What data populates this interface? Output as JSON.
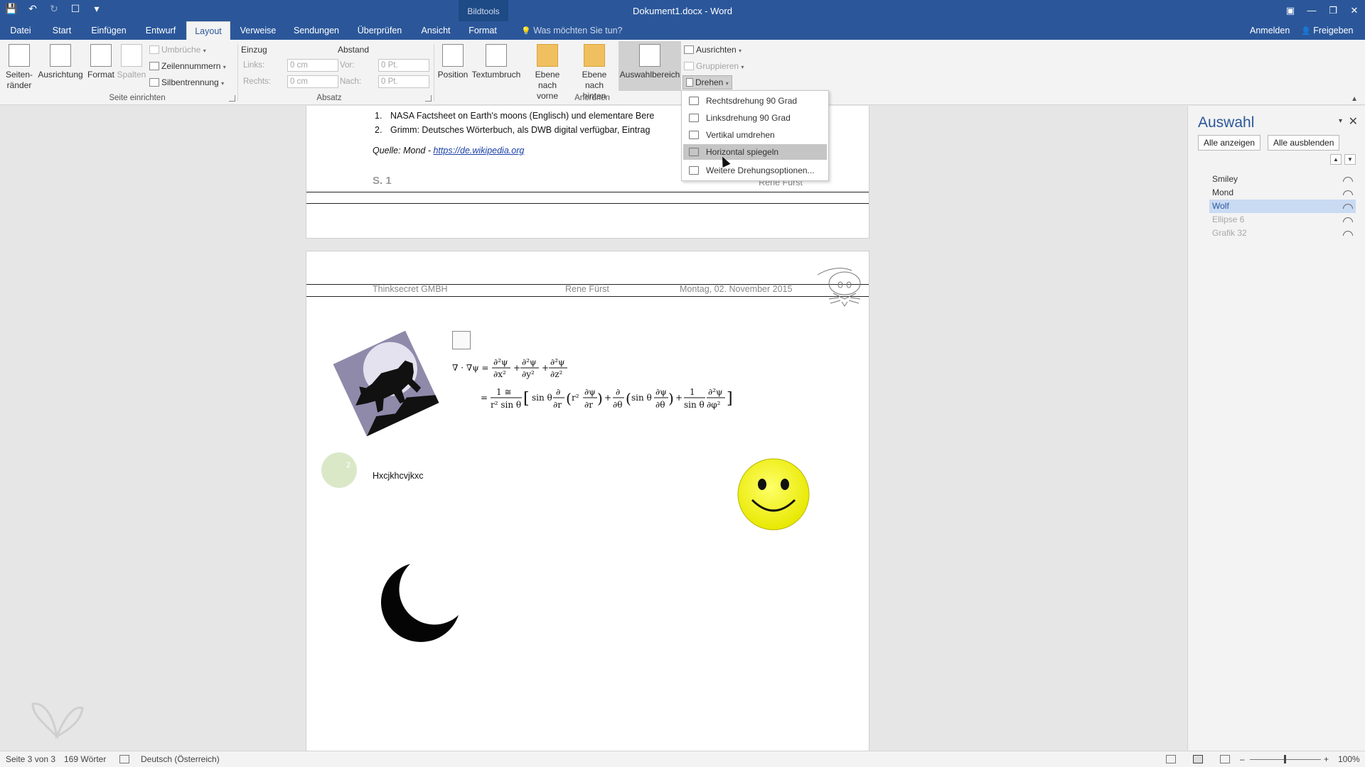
{
  "window": {
    "title": "Dokument1.docx - Word",
    "context_group": "Bildtools",
    "qat": {
      "save_icon": "💾",
      "undo_icon": "↶",
      "redo_icon": "↻",
      "touch_icon": "☐",
      "customize_icon": "▾"
    },
    "controls": {
      "ribbon_options": "▣",
      "minimize": "—",
      "restore": "❐",
      "close": "✕"
    }
  },
  "tabs": {
    "datei": "Datei",
    "start": "Start",
    "einfuegen": "Einfügen",
    "entwurf": "Entwurf",
    "layout": "Layout",
    "verweise": "Verweise",
    "sendungen": "Sendungen",
    "ueberpruefen": "Überprüfen",
    "ansicht": "Ansicht",
    "format": "Format",
    "tell_me": "Was möchten Sie tun?",
    "tell_me_icon": "💡",
    "anmelden": "Anmelden",
    "freigeben": "Freigeben",
    "share_icon": "👤"
  },
  "ribbon": {
    "seitenraender": "Seiten-\nränder",
    "ausrichtung": "Ausrichtung",
    "format": "Format",
    "spalten": "Spalten",
    "umbrueche": "Umbrüche",
    "zeilennummern": "Zeilennummern",
    "silbentrennung": "Silbentrennung",
    "einzug": "Einzug",
    "abstand": "Abstand",
    "links": "Links:",
    "rechts": "Rechts:",
    "vor": "Vor:",
    "nach": "Nach:",
    "links_val": "0 cm",
    "rechts_val": "0 cm",
    "vor_val": "0 Pt.",
    "nach_val": "0 Pt.",
    "position": "Position",
    "textumbruch": "Textumbruch",
    "ebene_vorne": "Ebene nach\nvorne",
    "ebene_hinten": "Ebene nach\nhinten",
    "auswahlbereich": "Auswahlbereich",
    "ausrichten": "Ausrichten",
    "gruppieren": "Gruppieren",
    "drehen": "Drehen",
    "group_seite": "Seite einrichten",
    "group_absatz": "Absatz",
    "group_anordnen": "Anordnen"
  },
  "drehen_menu": [
    "Rechtsdrehung 90 Grad",
    "Linksdrehung 90 Grad",
    "Vertikal umdrehen",
    "Horizontal spiegeln",
    "Weitere Drehungsoptionen..."
  ],
  "document": {
    "page1": {
      "list": [
        {
          "num": "1.",
          "text": "NASA Factsheet on Earth's moons (Englisch) und elementare Bere"
        },
        {
          "num": "2.",
          "text": "Grimm: Deutsches Wörterbuch, als DWB digital verfügbar, Eintrag"
        }
      ],
      "source_prefix": "Quelle: Mond - ",
      "source_link": "https://de.wikipedia.org",
      "footer_page": "S. 1",
      "footer_author": "Rene Fürst"
    },
    "page2": {
      "header_company": "Thinksecret GMBH",
      "header_author": "Rene Fürst",
      "header_date": "Montag, 02. November 2015",
      "bubble_label": "2",
      "body_text": "Hxcjkhcvjkxc",
      "eq": {
        "lhs": "∇ · ∇ψ =",
        "t1n": "∂²ψ",
        "t1d": "∂x²",
        "t2n": "∂²ψ",
        "t2d": "∂y²",
        "t3n": "∂²ψ",
        "t3d": "∂z²",
        "plus": "+",
        "eq2": "=",
        "f1n": "1 ≅",
        "f1d": "r² sin θ",
        "part_a": "sin θ",
        "d1n": "∂",
        "d1d": "∂r",
        "r2": "r²",
        "dpn": "∂ψ",
        "dpd": "∂r",
        "d2n": "∂",
        "d2d": "∂θ",
        "part_b": "sin θ",
        "dtn": "∂ψ",
        "dtd": "∂θ",
        "f2n": "1",
        "f2d": "sin θ",
        "dfn": "∂²ψ",
        "dfd": "∂φ²"
      }
    }
  },
  "selection_pane": {
    "title": "Auswahl",
    "show_all": "Alle anzeigen",
    "hide_all": "Alle ausblenden",
    "up_icon": "▲",
    "down_icon": "▼",
    "close_icon": "✕",
    "dropdown_icon": "▾",
    "items": [
      "Smiley",
      "Mond",
      "Wolf",
      "Ellipse 6",
      "Grafik 32"
    ]
  },
  "statusbar": {
    "page": "Seite 3 von 3",
    "words": "169 Wörter",
    "language": "Deutsch (Österreich)",
    "zoom_minus": "–",
    "zoom_plus": "+",
    "zoom": "100%"
  },
  "colors": {
    "accent": "#2b579a",
    "smiley": "#f2f20a",
    "highlight": "#c5c5c5"
  }
}
